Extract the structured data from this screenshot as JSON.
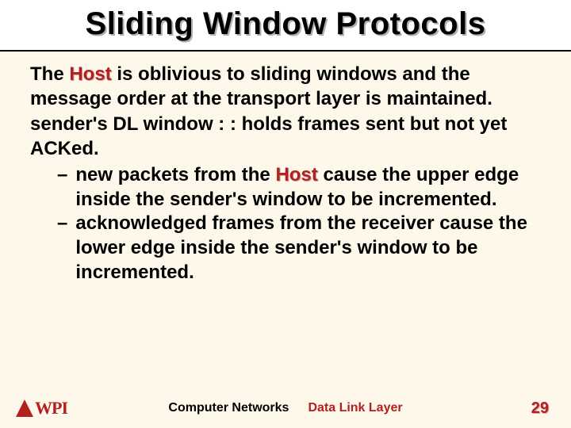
{
  "title": "Sliding Window Protocols",
  "body": {
    "p1_a": "The ",
    "p1_host": "Host",
    "p1_b": " is oblivious to sliding windows and the message order at the transport layer is maintained.",
    "p2": "sender's DL window : : holds frames sent but not yet ACKed.",
    "bullets": [
      {
        "dash": "–",
        "pre": "new packets from the ",
        "host": "Host",
        "post": " cause the upper edge inside the sender's window to be incremented."
      },
      {
        "dash": "–",
        "pre": "acknowledged  frames from the receiver cause the lower edge inside the sender's window to be incremented.",
        "host": "",
        "post": ""
      }
    ]
  },
  "footer": {
    "logo_text": "WPI",
    "center_a": "Computer Networks",
    "center_b": "Data Link Layer",
    "page": "29"
  }
}
